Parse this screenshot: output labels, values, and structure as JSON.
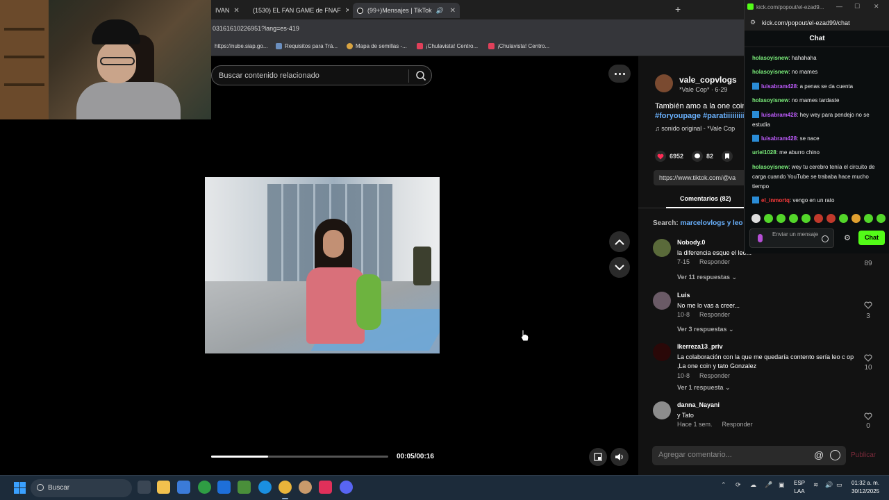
{
  "browser": {
    "tabs": [
      {
        "label": "IVAN",
        "icon": "tab-icon"
      },
      {
        "label": "(1530) EL FAN GAME de FNAF",
        "icon": "youtube-icon"
      },
      {
        "label": "(99+)Mensajes | TikTok",
        "icon": "tiktok-icon"
      }
    ],
    "url": "03161610226951?lang=es-419",
    "bookmarks": [
      "https://nube.siap.go...",
      "Requisitos para Trá...",
      "Mapa de semillas -...",
      "¡Chulavista! Centro...",
      "¡Chulavista! Centro..."
    ]
  },
  "tiktok": {
    "search_placeholder": "Buscar contenido relacionado",
    "player": {
      "time": "00:05/00:16",
      "progress": 0.32
    },
    "author": {
      "name": "vale_copvlogs",
      "sub": "*Vale Cop* · 6-29"
    },
    "description": "También amo a la one coin",
    "hashtags": "#foryoupage #paratiiiiiiiii",
    "sound": "♫  sonido original - *Vale Cop",
    "stats": {
      "likes": "6952",
      "comments": "82"
    },
    "link": "https://www.tiktok.com/@va",
    "comments_tab": "Comentarios (82)",
    "search_prefix": "Search:",
    "search_query": "marcelovlogs y leo",
    "comments": [
      {
        "name": "Nobody.0",
        "text": "la diferencia esque el leo...",
        "date": "7-15",
        "reply": "Responder",
        "replies": "Ver 11 respuestas ⌄",
        "likes": "89"
      },
      {
        "name": "Luis",
        "text": "No me lo vas a creer...",
        "date": "10-8",
        "reply": "Responder",
        "replies": "Ver 3 respuestas ⌄",
        "likes": "3"
      },
      {
        "name": "Ikerreza13_priv",
        "text": "La colaboración con la que me quedaría contento sería leo c op ,La one coin y tato Gonzalez",
        "date": "10-8",
        "reply": "Responder",
        "replies": "Ver 1 respuesta ⌄",
        "likes": "10"
      },
      {
        "name": "danna_Nayani",
        "text": "y Tato",
        "date": "Hace 1 sem.",
        "reply": "Responder",
        "replies": "",
        "likes": "0"
      }
    ],
    "add_comment_placeholder": "Agregar comentario...",
    "publish": "Publicar"
  },
  "kick": {
    "window_title": "kick.com/popout/el-ezad9...",
    "url": "kick.com/popout/el-ezad99/chat",
    "header": "Chat",
    "messages": [
      {
        "user": "holasoyisnew",
        "color": "#7cf07c",
        "badge": false,
        "text": "hahahaha"
      },
      {
        "user": "holasoyisnew",
        "color": "#7cf07c",
        "badge": false,
        "text": "no mames"
      },
      {
        "user": "luisabram428",
        "color": "#c05cff",
        "badge": true,
        "text": "a penas se da cuenta"
      },
      {
        "user": "holasoyisnew",
        "color": "#7cf07c",
        "badge": false,
        "text": "no mames tardaste"
      },
      {
        "user": "luisabram428",
        "color": "#c05cff",
        "badge": true,
        "text": "hey wey para pendejo no se estudia"
      },
      {
        "user": "luisabram428",
        "color": "#c05cff",
        "badge": true,
        "text": "se nace"
      },
      {
        "user": "uriel1028",
        "color": "#7cf07c",
        "badge": false,
        "text": "me aburro chino"
      },
      {
        "user": "holasoyisnew",
        "color": "#7cf07c",
        "badge": false,
        "text": "wey tu cerebro tenía el circuito de carga cuando YouTube se trababa hace mucho tiempo"
      },
      {
        "user": "el_inmortq",
        "color": "#ff3b3b",
        "badge": true,
        "text": "vengo en un rato"
      }
    ],
    "input_placeholder": "Enviar un mensaje",
    "chat_button": "Chat"
  },
  "taskbar": {
    "search": "Buscar",
    "lang1": "ESP",
    "lang2": "LAA",
    "time": "01:32 a. m.",
    "date": "30/12/2025"
  }
}
